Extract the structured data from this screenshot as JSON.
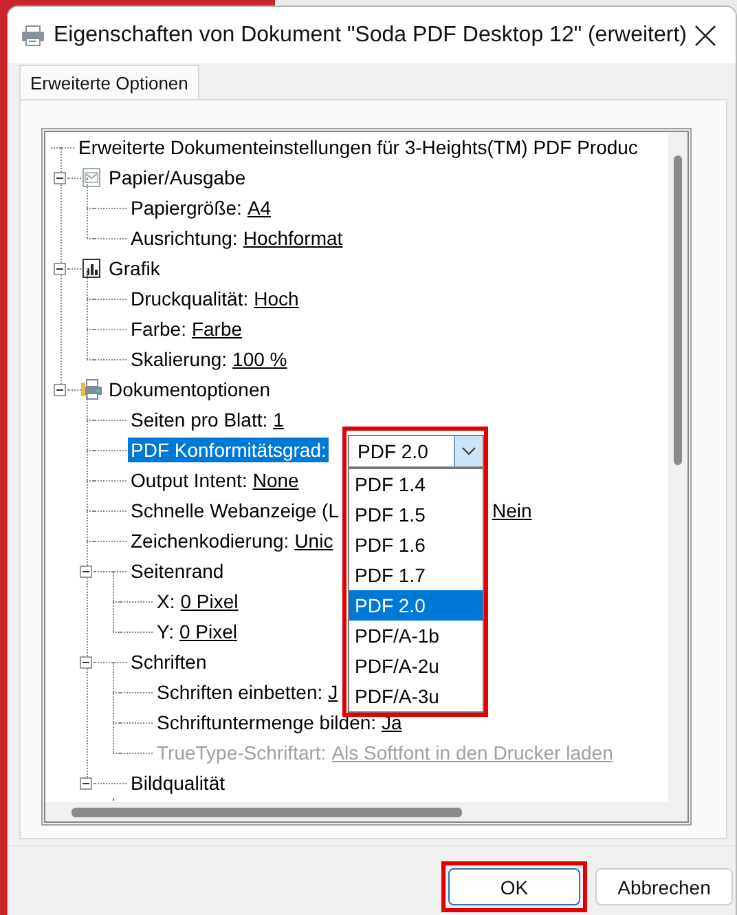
{
  "window": {
    "title": "Eigenschaften von Dokument \"Soda PDF Desktop 12\" (erweitert)"
  },
  "tabs": [
    {
      "label": "Erweiterte Optionen",
      "selected": true
    }
  ],
  "tree": {
    "root": "Erweiterte Dokumenteinstellungen für 3-Heights(TM) PDF Produc",
    "items": [
      {
        "kind": "group",
        "label": "Papier/Ausgabe",
        "expanded": true,
        "children": [
          {
            "kind": "option",
            "label": "Papiergröße:",
            "value": "A4",
            "disabled": false,
            "selected": false
          },
          {
            "kind": "option",
            "label": "Ausrichtung:",
            "value": "Hochformat",
            "disabled": false,
            "selected": false
          }
        ]
      },
      {
        "kind": "group",
        "label": "Grafik",
        "expanded": true,
        "children": [
          {
            "kind": "option",
            "label": "Druckqualität:",
            "value": "Hoch",
            "disabled": false,
            "selected": false
          },
          {
            "kind": "option",
            "label": "Farbe:",
            "value": "Farbe",
            "disabled": false,
            "selected": false
          },
          {
            "kind": "option",
            "label": "Skalierung:",
            "value": "100 %",
            "disabled": false,
            "selected": false
          }
        ]
      },
      {
        "kind": "group",
        "label": "Dokumentoptionen",
        "expanded": true,
        "children": [
          {
            "kind": "option",
            "label": "Seiten pro Blatt:",
            "value": "1",
            "disabled": false,
            "selected": false
          },
          {
            "kind": "combo",
            "label": "PDF Konformitätsgrad:",
            "value": "PDF 2.0",
            "disabled": false,
            "selected": true,
            "open": true,
            "highlighted": true,
            "options": [
              {
                "label": "PDF 1.4",
                "selected": false
              },
              {
                "label": "PDF 1.5",
                "selected": false
              },
              {
                "label": "PDF 1.6",
                "selected": false
              },
              {
                "label": "PDF 1.7",
                "selected": false
              },
              {
                "label": "PDF 2.0",
                "selected": true
              },
              {
                "label": "PDF/A-1b",
                "selected": false
              },
              {
                "label": "PDF/A-2u",
                "selected": false
              },
              {
                "label": "PDF/A-3u",
                "selected": false
              }
            ]
          },
          {
            "kind": "option",
            "label": "Output Intent:",
            "value": "None",
            "disabled": false,
            "selected": false
          },
          {
            "kind": "option",
            "label": "Schnelle Webanzeige (L",
            "value_after_overlay": "Nein",
            "disabled": false,
            "selected": false
          },
          {
            "kind": "option",
            "label": "Zeichenkodierung:",
            "value": "Unic",
            "disabled": false,
            "selected": false
          },
          {
            "kind": "group",
            "label": "Seitenrand",
            "expanded": true,
            "children": [
              {
                "kind": "option",
                "label": "X:",
                "value": "0 Pixel",
                "disabled": false,
                "selected": false
              },
              {
                "kind": "option",
                "label": "Y:",
                "value": "0 Pixel",
                "disabled": false,
                "selected": false
              }
            ]
          },
          {
            "kind": "group",
            "label": "Schriften",
            "expanded": true,
            "children": [
              {
                "kind": "option",
                "label": "Schriften einbetten:",
                "value": "J",
                "disabled": false,
                "selected": false
              },
              {
                "kind": "option",
                "label": "Schriftuntermenge bilden:",
                "value": "Ja",
                "disabled": false,
                "selected": false
              },
              {
                "kind": "option",
                "label": "TrueType-Schriftart:",
                "value": "Als Softfont in den Drucker laden",
                "disabled": true,
                "selected": false
              }
            ]
          },
          {
            "kind": "group",
            "label": "Bildqualität",
            "expanded": true
          }
        ]
      }
    ]
  },
  "buttons": [
    {
      "label": "OK",
      "default": true,
      "highlighted": true
    },
    {
      "label": "Abbrechen",
      "default": false,
      "highlighted": false
    }
  ]
}
